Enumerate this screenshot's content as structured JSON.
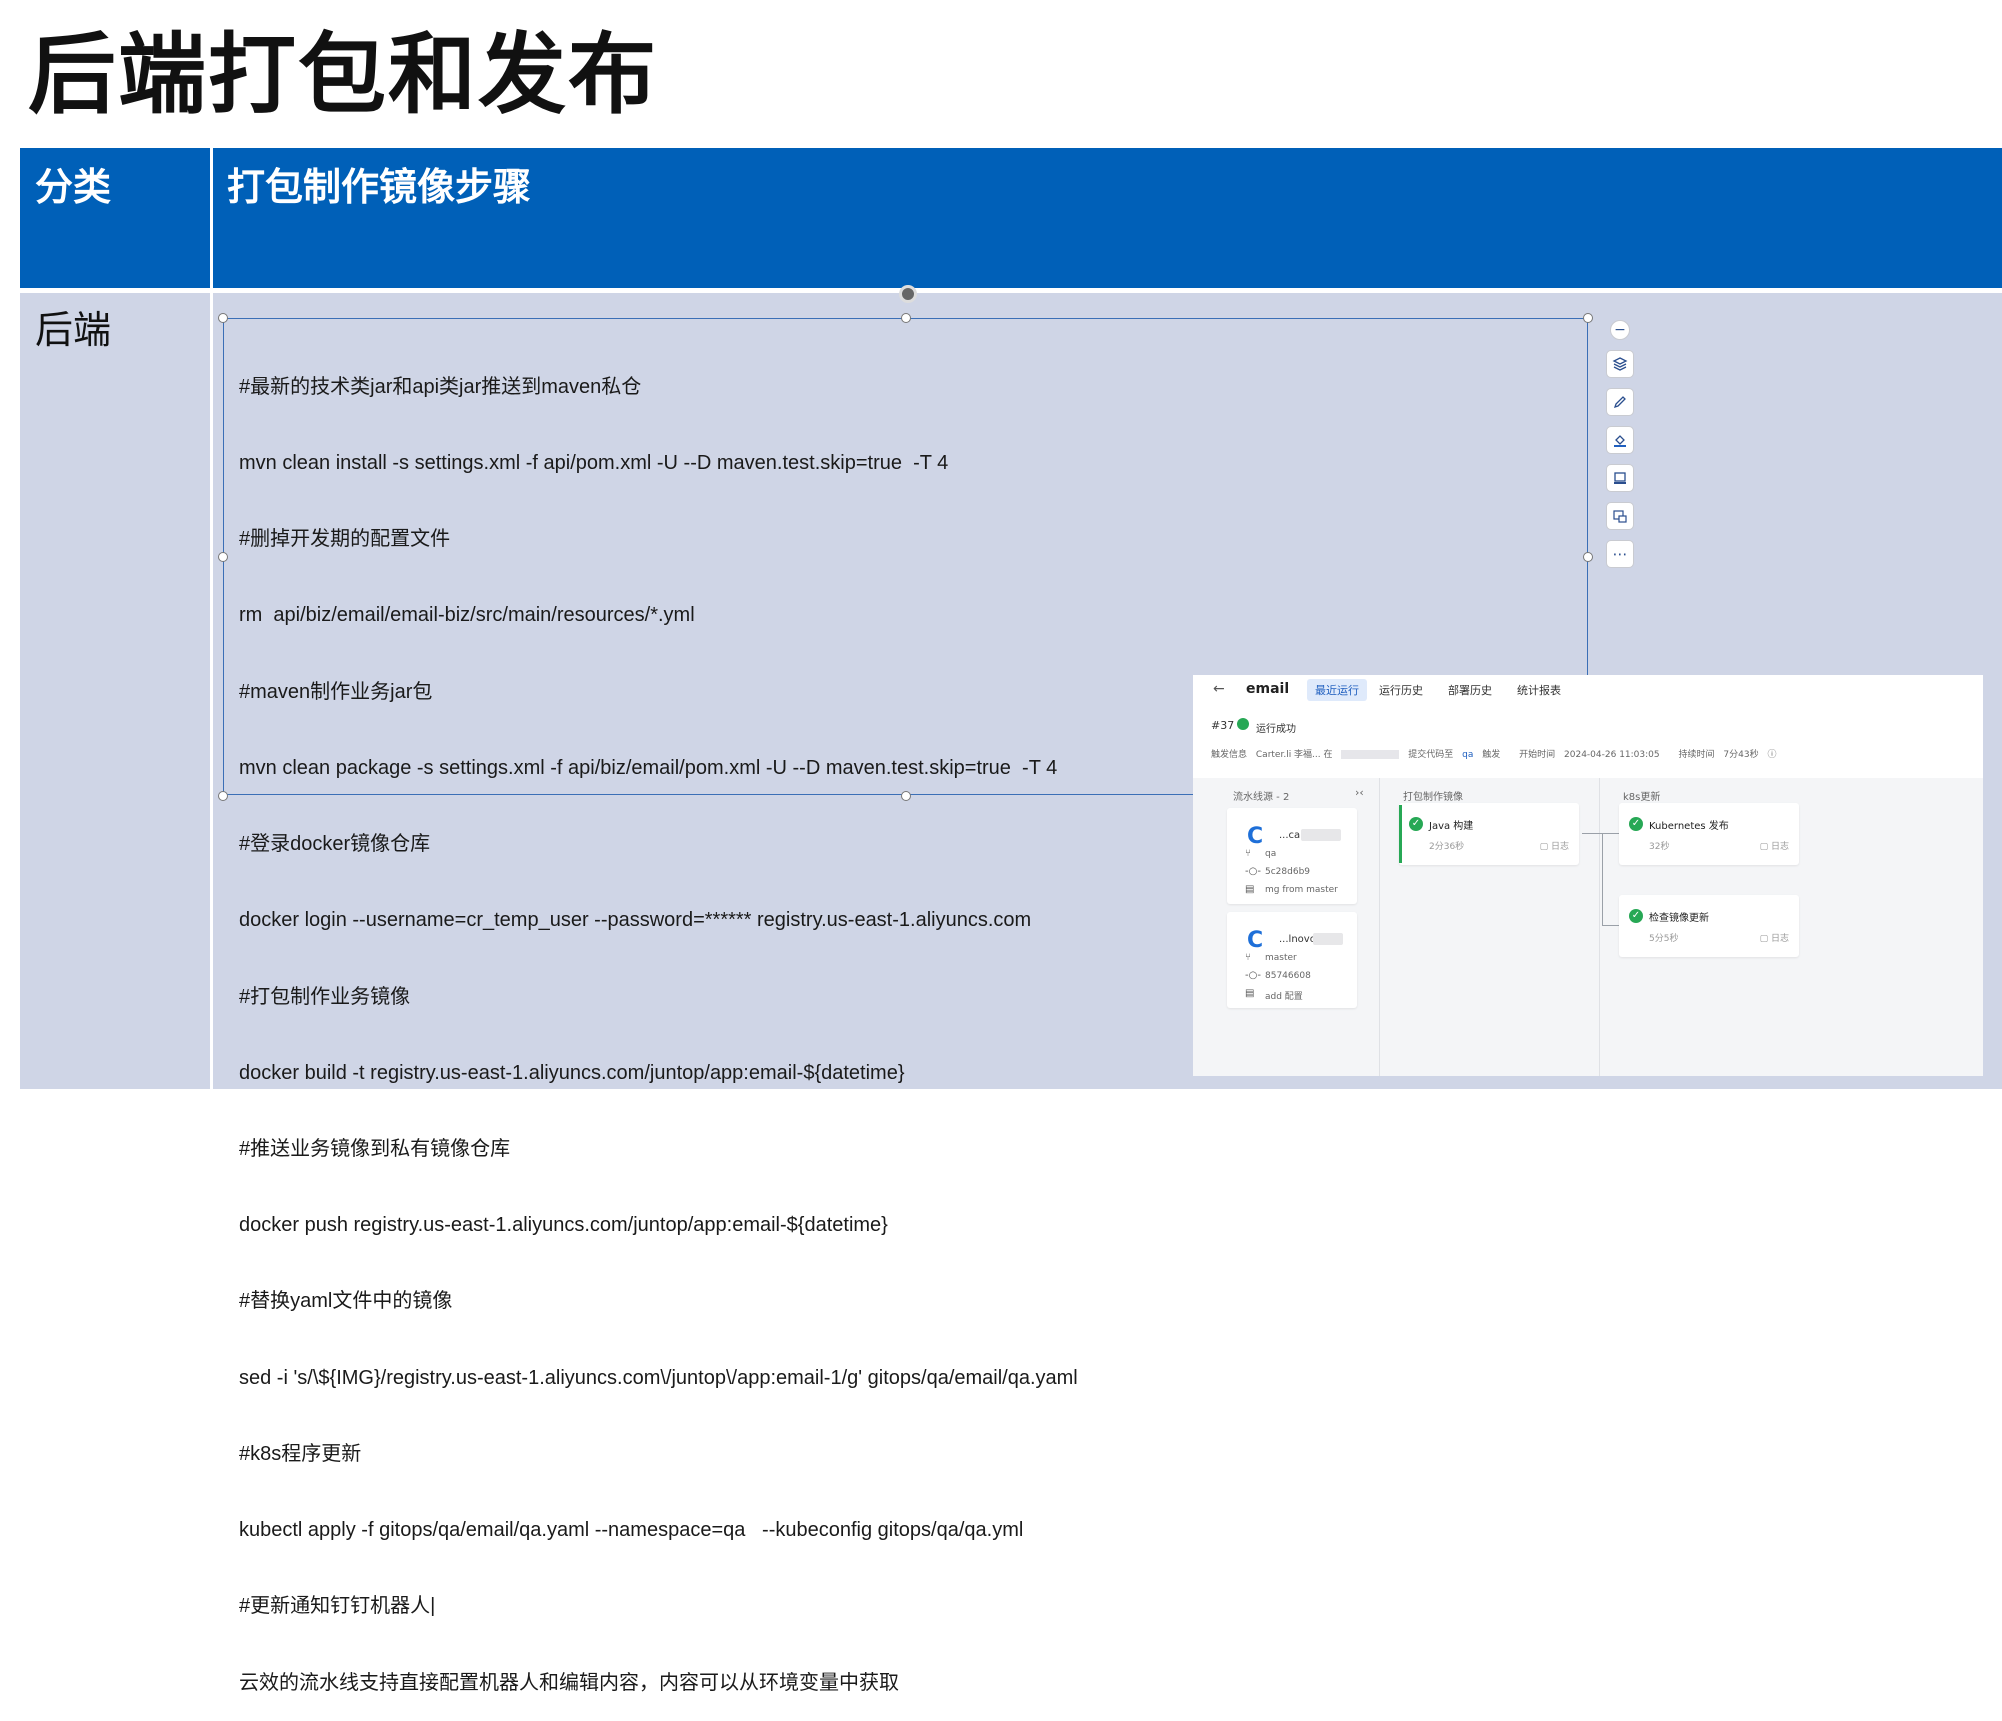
{
  "slide": {
    "title": "后端打包和发布"
  },
  "table": {
    "header": {
      "category": "分类",
      "steps": "打包制作镜像步骤"
    },
    "row": {
      "category": "后端",
      "script_lines": [
        "#最新的技术类jar和api类jar推送到maven私仓",
        "mvn clean install -s settings.xml -f api/pom.xml -U --D maven.test.skip=true  -T 4",
        "#删掉开发期的配置文件",
        "rm  api/biz/email/email-biz/src/main/resources/*.yml",
        "#maven制作业务jar包",
        "mvn clean package -s settings.xml -f api/biz/email/pom.xml -U --D maven.test.skip=true  -T 4",
        "#登录docker镜像仓库",
        "docker login --username=cr_temp_user --password=****** registry.us-east-1.aliyuncs.com",
        "#打包制作业务镜像",
        "docker build -t registry.us-east-1.aliyuncs.com/juntop/app:email-${datetime}",
        "#推送业务镜像到私有镜像仓库",
        "docker push registry.us-east-1.aliyuncs.com/juntop/app:email-${datetime}",
        "#替换yaml文件中的镜像",
        "sed -i 's/\\${IMG}/registry.us-east-1.aliyuncs.com\\/juntop\\/app:email-1/g' gitops/qa/email/qa.yaml",
        "#k8s程序更新",
        "kubectl apply -f gitops/qa/email/qa.yaml --namespace=qa   --kubeconfig gitops/qa/qa.yml",
        "#更新通知钉钉机器人|",
        "云效的流水线支持直接配置机器人和编辑内容，内容可以从环境变量中获取"
      ]
    }
  },
  "toolbar_icons": [
    "minus-icon",
    "layers-icon",
    "pen-icon",
    "fill-icon",
    "frame-icon",
    "replace-image-icon",
    "more-icon"
  ],
  "pipeline": {
    "back": "←",
    "app_name": "email",
    "tabs": [
      "最近运行",
      "运行历史",
      "部署历史",
      "统计报表"
    ],
    "active_tab": "最近运行",
    "run_id": "#37",
    "run_status": "运行成功",
    "trigger_label": "触发信息",
    "trigger_user": "Carter.li 李福... 在",
    "trigger_action": "提交代码至",
    "trigger_branch": "qa",
    "trigger_suffix": "触发",
    "start_label": "开始时间",
    "start_time": "2024-04-26 11:03:05",
    "duration_label": "持续时间",
    "duration": "7分43秒",
    "stages": {
      "sources_header": "流水线源 - 2",
      "build_header": "打包制作镜像",
      "k8s_header": "k8s更新"
    },
    "sources": [
      {
        "name": "...ca",
        "branch": "qa",
        "commit": "5c28d6b9",
        "message": "mg from master"
      },
      {
        "name": "...lnovo/",
        "branch": "master",
        "commit": "85746608",
        "message": "add 配置"
      }
    ],
    "jobs": {
      "java_build": {
        "name": "Java 构建",
        "time": "2分36秒",
        "log": "日志"
      },
      "k8s_deploy": {
        "name": "Kubernetes 发布",
        "time": "32秒",
        "log": "日志"
      },
      "image_check": {
        "name": "检查镜像更新",
        "time": "5分5秒",
        "log": "日志"
      }
    },
    "colors": {
      "success": "#27a855",
      "accent": "#1f5fbf",
      "header_blue": "#0060B8"
    }
  }
}
